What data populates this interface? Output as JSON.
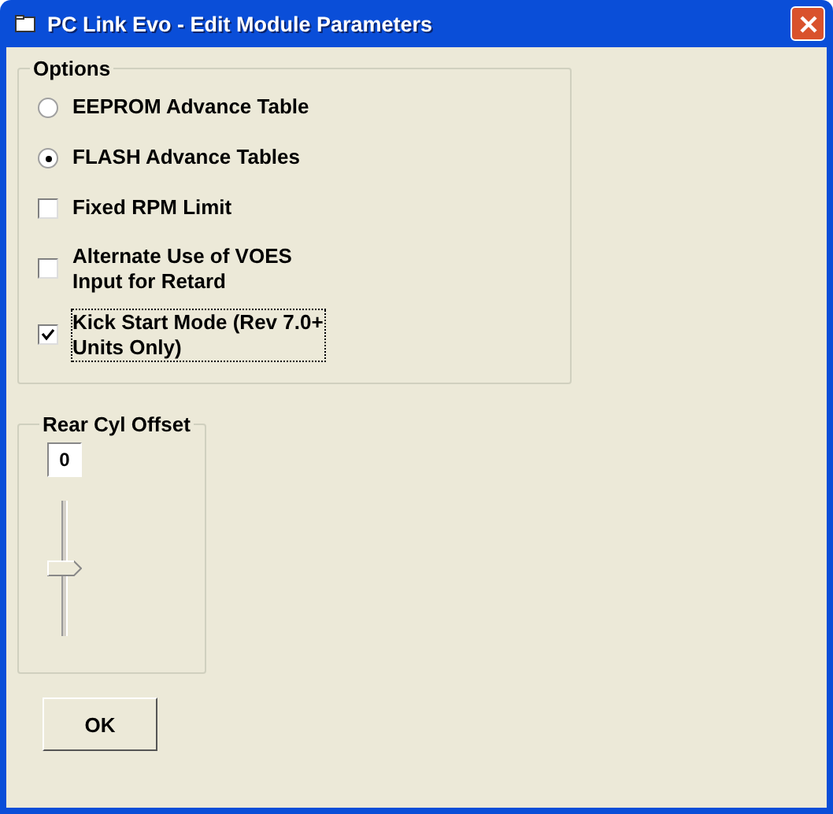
{
  "window": {
    "title": "PC Link Evo - Edit Module Parameters"
  },
  "options": {
    "title": "Options",
    "items": [
      {
        "kind": "radio",
        "label": "EEPROM Advance Table",
        "selected": false,
        "focused": false
      },
      {
        "kind": "radio",
        "label": "FLASH Advance Tables",
        "selected": true,
        "focused": false
      },
      {
        "kind": "checkbox",
        "label": "Fixed RPM Limit",
        "checked": false,
        "focused": false
      },
      {
        "kind": "checkbox",
        "label": "Alternate Use of VOES Input for Retard",
        "checked": false,
        "focused": false
      },
      {
        "kind": "checkbox",
        "label": "Kick Start Mode (Rev 7.0+ Units Only)",
        "checked": true,
        "focused": true
      }
    ]
  },
  "rear_cyl_offset": {
    "title": "Rear Cyl Offset",
    "value": "0",
    "level": 0.5
  },
  "buttons": [
    "OK"
  ]
}
